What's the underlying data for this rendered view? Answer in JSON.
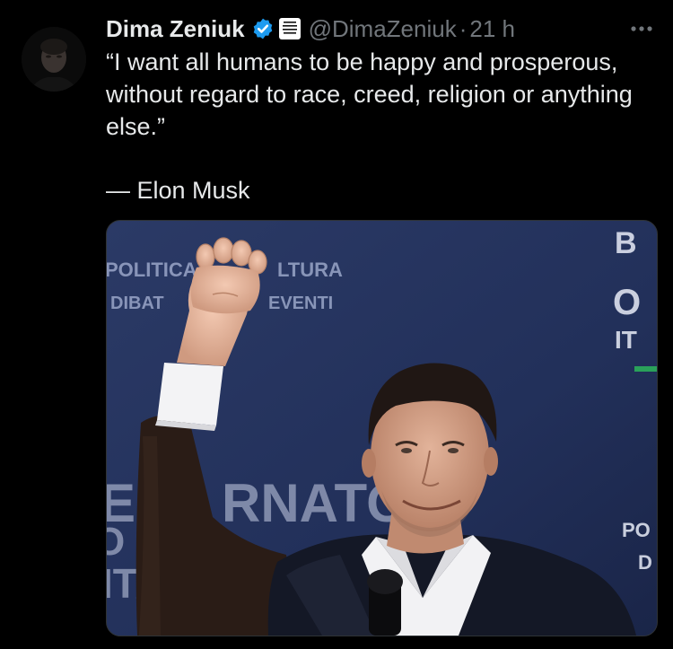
{
  "post": {
    "author": {
      "display_name": "Dima Zeniuk",
      "handle": "@DimaZeniuk",
      "verified_icon": "verified-badge-icon",
      "org_badge_icon": "tesla-owners-silicon-valley-badge",
      "org_badge_text": [
        "TESLA",
        "OWNERS",
        "SILICON",
        "VALLEY"
      ]
    },
    "separator": "·",
    "timestamp": "21 h",
    "more_icon": "more-options-icon",
    "quote_text": "“I want all humans to be happy and prosperous, without regard to race, creed, religion or anything else.”",
    "attribution": "— Elon Musk",
    "media": {
      "type": "photo",
      "backdrop_text": {
        "line1_left": "POLITICA",
        "line1_right": "LTURA",
        "line2_left": "DIBAT",
        "line2_right": "EVENTI",
        "big_mid": "RNATO",
        "big_left": "E",
        "big_left2": "O",
        "big_left3": "ITA",
        "right_top": "B",
        "right_mid": "O",
        "right_mid2": "IT",
        "right_bottom": "PO",
        "right_bottom2": "D"
      }
    }
  },
  "colors": {
    "background": "#000000",
    "text_primary": "#e7e9ea",
    "text_secondary": "#71767b",
    "verified_blue": "#1d9bf0",
    "backdrop_blue": "#22305a"
  }
}
